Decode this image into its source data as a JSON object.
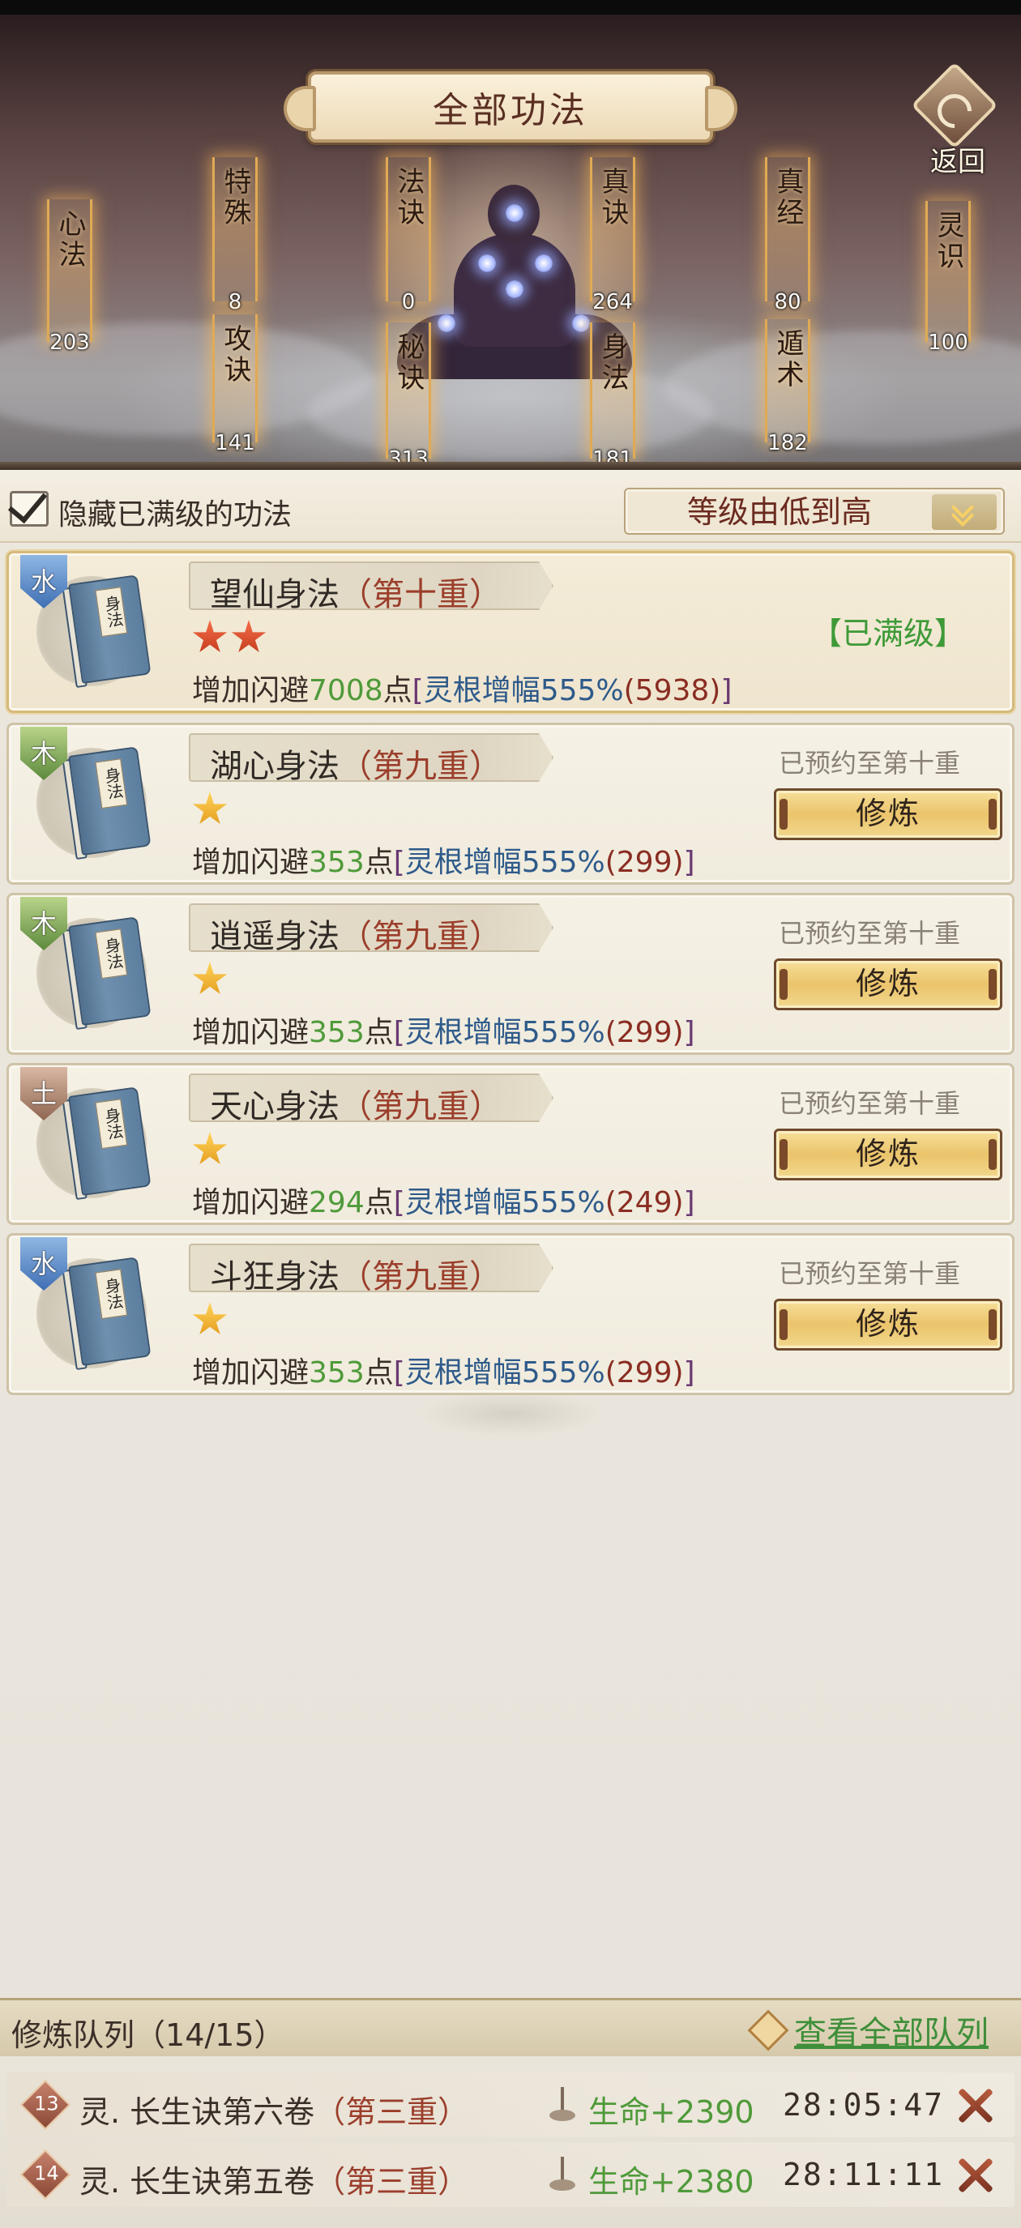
{
  "header": {
    "title": "全部功法",
    "back_label": "返回"
  },
  "categories": [
    {
      "label": "心法",
      "count": "203"
    },
    {
      "label": "特殊",
      "count": "8"
    },
    {
      "label": "攻诀",
      "count": "141"
    },
    {
      "label": "法诀",
      "count": "0"
    },
    {
      "label": "秘诀",
      "count": "313"
    },
    {
      "label": "真诀",
      "count": "264"
    },
    {
      "label": "身法",
      "count": "181"
    },
    {
      "label": "真经",
      "count": "80"
    },
    {
      "label": "遁术",
      "count": "182"
    },
    {
      "label": "灵识",
      "count": "100"
    }
  ],
  "filter": {
    "hide_maxed_label": "隐藏已满级的功法",
    "hide_maxed_checked": true,
    "sort_value": "等级由低到高"
  },
  "skills": [
    {
      "element": "水",
      "element_type": "water",
      "book_tag": "身法",
      "name": "望仙身法",
      "tier": "（第十重）",
      "stars": 2,
      "star_color": "red",
      "effect_prefix": "增加闪避",
      "effect_value": "7008",
      "effect_unit": "点",
      "boost_open": "[",
      "boost_label": "灵根增幅555%",
      "boost_sub": "(5938)",
      "boost_close": "]",
      "status": "【已满级】",
      "maxed": true
    },
    {
      "element": "木",
      "element_type": "wood",
      "book_tag": "身法",
      "name": "湖心身法",
      "tier": "（第九重）",
      "stars": 1,
      "star_color": "gold",
      "effect_prefix": "增加闪避",
      "effect_value": "353",
      "effect_unit": "点",
      "boost_open": "[",
      "boost_label": "灵根增幅555%",
      "boost_sub": "(299)",
      "boost_close": "]",
      "reserve": "已预约至第十重",
      "button": "修炼",
      "maxed": false
    },
    {
      "element": "木",
      "element_type": "wood",
      "book_tag": "身法",
      "name": "逍遥身法",
      "tier": "（第九重）",
      "stars": 1,
      "star_color": "gold",
      "effect_prefix": "增加闪避",
      "effect_value": "353",
      "effect_unit": "点",
      "boost_open": "[",
      "boost_label": "灵根增幅555%",
      "boost_sub": "(299)",
      "boost_close": "]",
      "reserve": "已预约至第十重",
      "button": "修炼",
      "maxed": false
    },
    {
      "element": "土",
      "element_type": "earth",
      "book_tag": "身法",
      "name": "天心身法",
      "tier": "（第九重）",
      "stars": 1,
      "star_color": "gold",
      "effect_prefix": "增加闪避",
      "effect_value": "294",
      "effect_unit": "点",
      "boost_open": "[",
      "boost_label": "灵根增幅555%",
      "boost_sub": "(249)",
      "boost_close": "]",
      "reserve": "已预约至第十重",
      "button": "修炼",
      "maxed": false
    },
    {
      "element": "水",
      "element_type": "water",
      "book_tag": "身法",
      "name": "斗狂身法",
      "tier": "（第九重）",
      "stars": 1,
      "star_color": "gold",
      "effect_prefix": "增加闪避",
      "effect_value": "353",
      "effect_unit": "点",
      "boost_open": "[",
      "boost_label": "灵根增幅555%",
      "boost_sub": "(299)",
      "boost_close": "]",
      "reserve": "已预约至第十重",
      "button": "修炼",
      "maxed": false
    }
  ],
  "queue": {
    "title": "修炼队列",
    "count": "（14/15）",
    "view_all": "查看全部队列",
    "items": [
      {
        "index": "13",
        "name": "灵. 长生诀第六卷",
        "tier": "（第三重）",
        "value": "生命+2390",
        "time": "28:05:47"
      },
      {
        "index": "14",
        "name": "灵. 长生诀第五卷",
        "tier": "（第三重）",
        "value": "生命+2380",
        "time": "28:11:11"
      }
    ]
  },
  "colors": {
    "accent_red": "#9b3e2b",
    "value_green": "#4f9a3a",
    "boost_blue": "#2e5a8a",
    "button_gold": "#ebc46b"
  }
}
